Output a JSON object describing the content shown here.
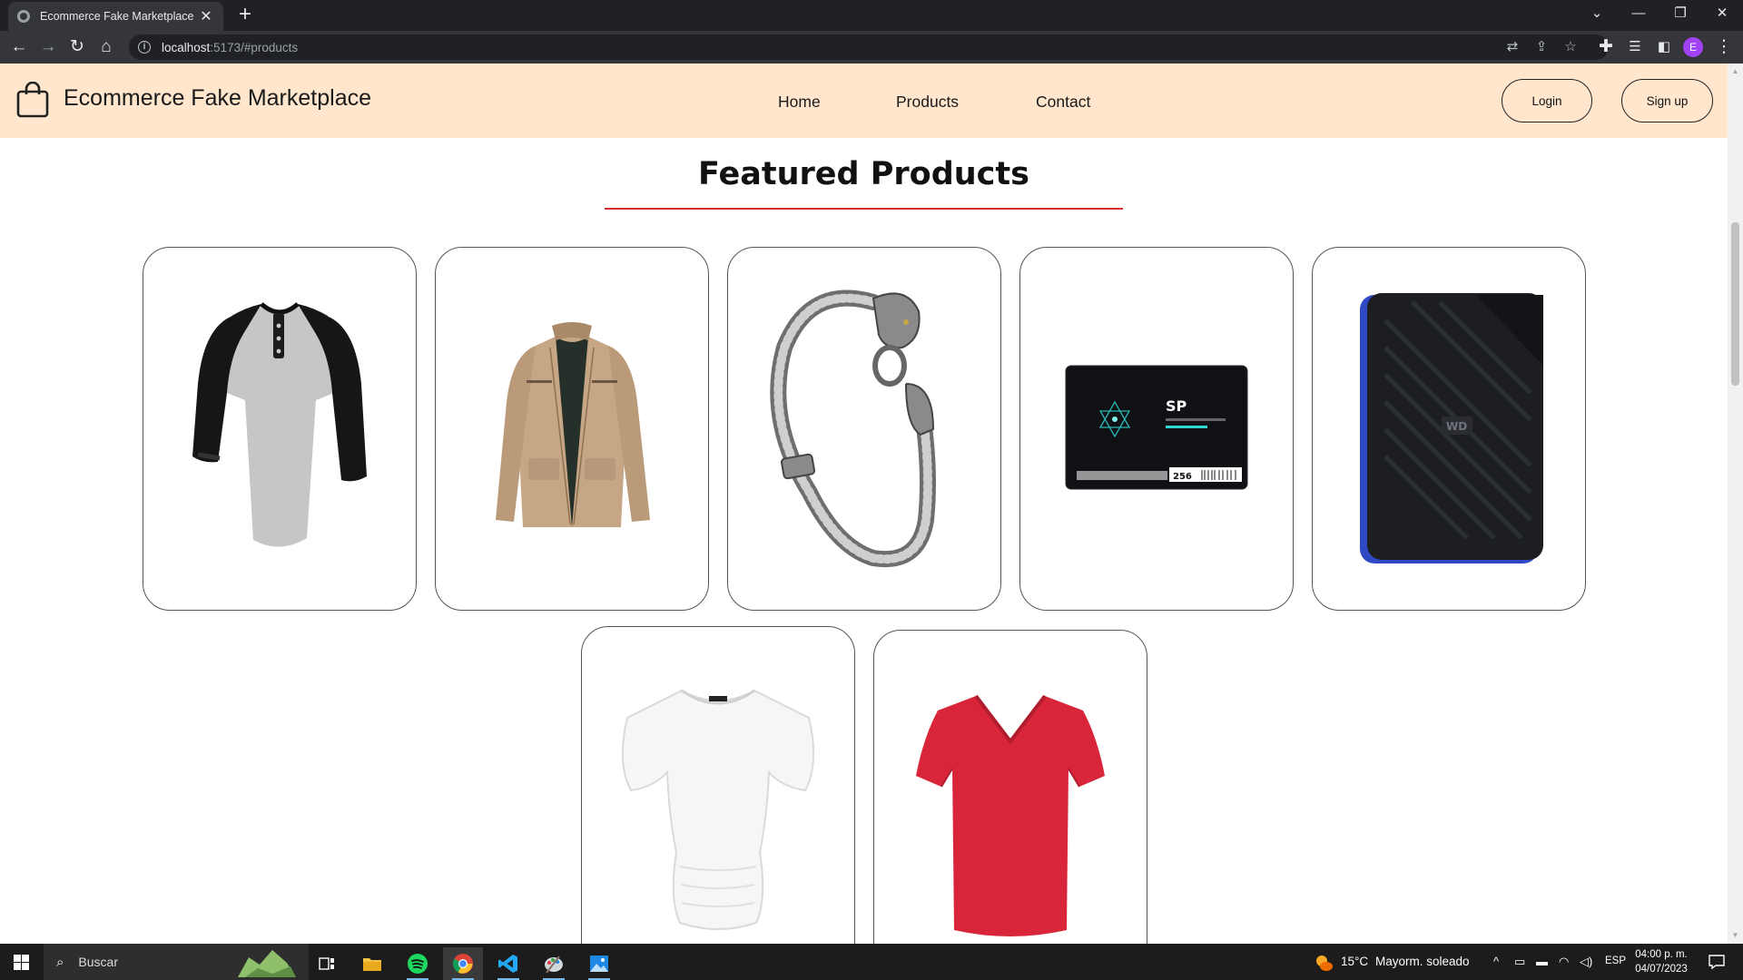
{
  "browser": {
    "tab_title": "Ecommerce Fake Marketplace",
    "tab_close": "✕",
    "new_tab": "+",
    "url_host": "localhost",
    "url_path": ":5173/#products",
    "profile_initial": "E"
  },
  "site": {
    "brand": "Ecommerce Fake Marketplace",
    "nav_links": [
      "Home",
      "Products",
      "Contact"
    ],
    "login_label": "Login",
    "signup_label": "Sign up",
    "nav_background": "#ffe6cd"
  },
  "products_section": {
    "title": "Featured Products",
    "rule_color": "#d32f2f",
    "products": [
      {
        "image": "raglan-henley-shirt-image"
      },
      {
        "image": "khaki-jacket-image"
      },
      {
        "image": "dragon-bracelet-image"
      },
      {
        "image": "ssd-drive-image",
        "printed_text": "SP",
        "capacity": "256"
      },
      {
        "image": "external-hard-drive-image",
        "printed_text": "WD"
      },
      {
        "image": "white-womens-top-image"
      },
      {
        "image": "red-vneck-tshirt-image"
      }
    ]
  },
  "taskbar": {
    "search_placeholder": "Buscar",
    "weather_temp": "15°C",
    "weather_desc": "Mayorm. soleado",
    "language": "ESP",
    "time": "04:00 p. m.",
    "date": "04/07/2023"
  }
}
